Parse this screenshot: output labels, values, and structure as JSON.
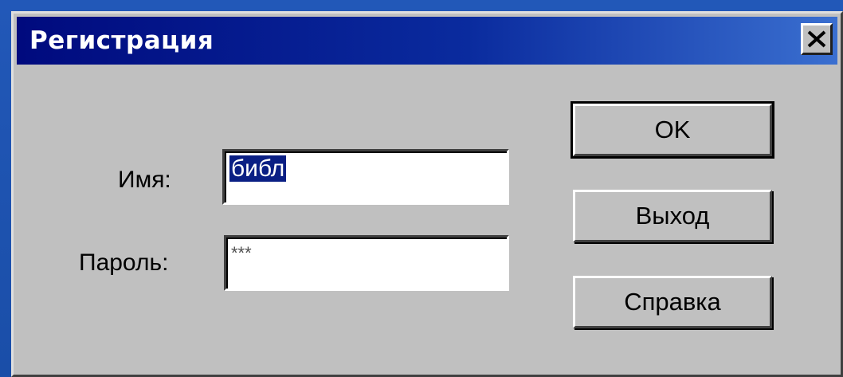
{
  "window": {
    "title": "Регистрация",
    "close_icon": "close-icon"
  },
  "form": {
    "username_label": "Имя:",
    "username_value": "библ",
    "password_label": "Пароль:",
    "password_value": "***"
  },
  "buttons": {
    "ok_label": "OK",
    "exit_label": "Выход",
    "help_label": "Справка"
  },
  "colors": {
    "titlebar_start": "#000a7e",
    "titlebar_end": "#3a6fd0",
    "dialog_face": "#c0c0c0",
    "selection": "#0a1f84"
  }
}
